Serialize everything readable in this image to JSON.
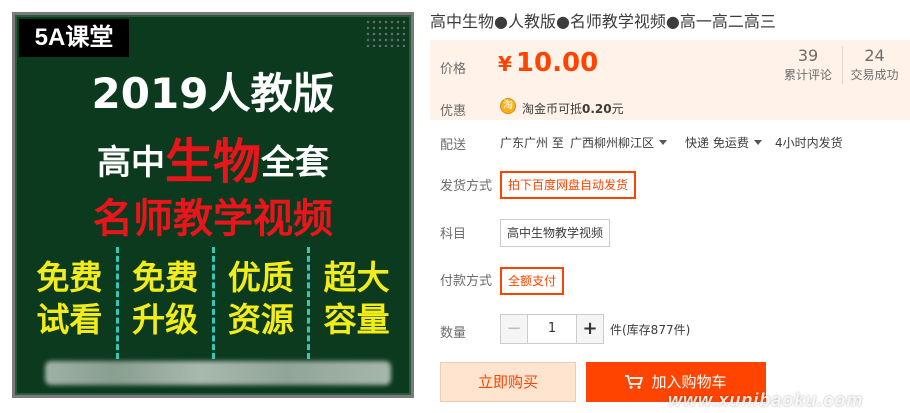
{
  "product_image": {
    "brand": "5A课堂",
    "year_line": "2019人教版",
    "subject_prefix": "高中",
    "subject_main": "生物",
    "subject_suffix": "全套",
    "teacher_line": "名师教学视频",
    "features": [
      {
        "line1": "免费",
        "line2": "试看"
      },
      {
        "line1": "免费",
        "line2": "升级"
      },
      {
        "line1": "优质",
        "line2": "资源"
      },
      {
        "line1": "超大",
        "line2": "容量"
      }
    ]
  },
  "detail": {
    "title": "高中生物●人教版●名师教学视频●高一高二高三",
    "price_label": "价格",
    "currency": "¥",
    "price": "10.00",
    "stats": [
      {
        "value": "39",
        "label": "累计评论"
      },
      {
        "value": "24",
        "label": "交易成功"
      }
    ],
    "promo_label": "优惠",
    "promo_icon_char": "淘",
    "promo_text_prefix": "淘金币可抵",
    "promo_amount": "0.20",
    "promo_text_suffix": "元",
    "shipping_label": "配送",
    "ship_from": "广东广州 至",
    "ship_to": "广西柳州柳江区",
    "ship_method": "快递 免运费",
    "ship_time": "4小时内发货",
    "delivery_method_label": "发货方式",
    "delivery_method_option": "拍下百度网盘自动发货",
    "subject_label": "科目",
    "subject_option": "高中生物教学视频",
    "payment_label": "付款方式",
    "payment_option": "全额支付",
    "quantity_label": "数量",
    "quantity_minus": "−",
    "quantity_value": "1",
    "quantity_plus": "+",
    "stock_text": "件(库存877件)",
    "buy_now": "立即购买",
    "add_to_cart": "加入购物车"
  },
  "watermark": "www.xunibaoku.com",
  "colors": {
    "accent": "#ff4400",
    "price_bg": "#fff2e8",
    "board_bg": "#0b3a1f",
    "feature_yellow": "#f2ec1a",
    "headline_red": "#e8151b"
  }
}
